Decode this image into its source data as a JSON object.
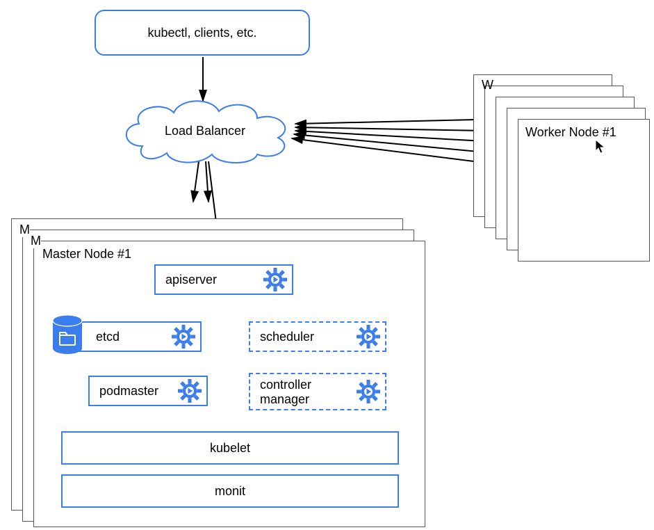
{
  "top": {
    "label": "kubectl, clients, etc."
  },
  "cloud": {
    "label": "Load Balancer"
  },
  "worker": {
    "titles": [
      "Worker Node #1",
      "Worker Node #1",
      "Worker Node #1",
      "Worker Node #1",
      "Worker Node #1"
    ]
  },
  "master": {
    "titles": [
      "Master Node #1",
      "Master Node #1",
      "Master Node #1"
    ],
    "apiserver": "apiserver",
    "etcd": "etcd",
    "podmaster": "podmaster",
    "scheduler": "scheduler",
    "controller_manager_line1": "controller",
    "controller_manager_line2": "manager",
    "kubelet": "kubelet",
    "monit": "monit"
  },
  "icons": {
    "gear": "gear-icon",
    "database": "database-icon",
    "folder": "folder-icon",
    "cursor": "cursor-icon"
  },
  "colors": {
    "blue": "#3b7ded",
    "blue_fill": "#3b7ded",
    "gray": "#8a8a8a"
  }
}
